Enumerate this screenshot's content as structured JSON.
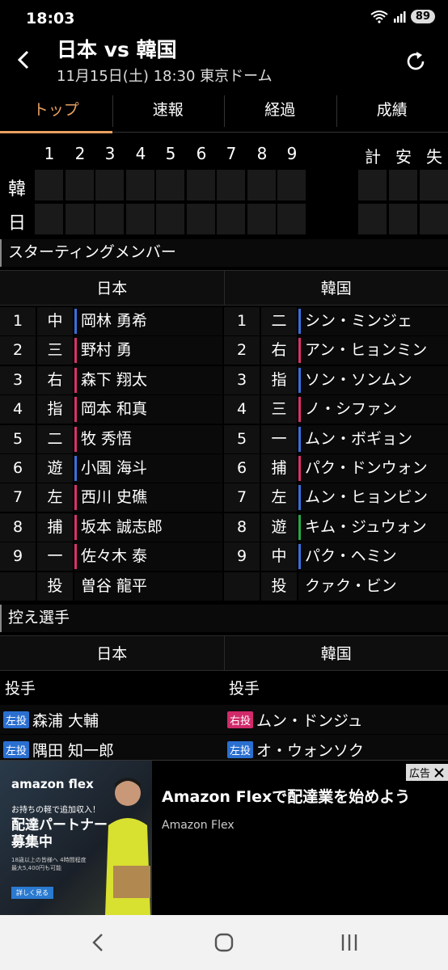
{
  "status": {
    "time": "18:03",
    "battery": "89"
  },
  "header": {
    "title": "日本 vs 韓国",
    "subtitle": "11月15日(土) 18:30 東京ドーム"
  },
  "tabs": [
    {
      "label": "トップ",
      "active": true
    },
    {
      "label": "速報",
      "active": false
    },
    {
      "label": "経過",
      "active": false
    },
    {
      "label": "成績",
      "active": false
    }
  ],
  "scoreboard": {
    "innings": [
      "1",
      "2",
      "3",
      "4",
      "5",
      "6",
      "7",
      "8",
      "9"
    ],
    "totals": [
      "計",
      "安",
      "失"
    ],
    "teams": [
      "韓",
      "日"
    ]
  },
  "starting": {
    "title": "スターティングメンバー",
    "team_left": "日本",
    "team_right": "韓国",
    "left": [
      {
        "num": "1",
        "pos": "中",
        "name": "岡林 勇希",
        "bar": "#3a6fd8"
      },
      {
        "num": "2",
        "pos": "三",
        "name": "野村 勇",
        "bar": "#d8336a"
      },
      {
        "num": "3",
        "pos": "右",
        "name": "森下 翔太",
        "bar": "#d8336a"
      },
      {
        "num": "4",
        "pos": "指",
        "name": "岡本 和真",
        "bar": "#d8336a"
      },
      {
        "num": "5",
        "pos": "二",
        "name": "牧 秀悟",
        "bar": "#d8336a"
      },
      {
        "num": "6",
        "pos": "遊",
        "name": "小園 海斗",
        "bar": "#3a6fd8"
      },
      {
        "num": "7",
        "pos": "左",
        "name": "西川 史礁",
        "bar": "#d8336a"
      },
      {
        "num": "8",
        "pos": "捕",
        "name": "坂本 誠志郎",
        "bar": "#d8336a"
      },
      {
        "num": "9",
        "pos": "一",
        "name": "佐々木 泰",
        "bar": "#d8336a"
      },
      {
        "num": "",
        "pos": "投",
        "name": "曽谷 龍平",
        "bar": ""
      }
    ],
    "right": [
      {
        "num": "1",
        "pos": "二",
        "name": "シン・ミンジェ",
        "bar": "#3a6fd8"
      },
      {
        "num": "2",
        "pos": "右",
        "name": "アン・ヒョンミン",
        "bar": "#d8336a"
      },
      {
        "num": "3",
        "pos": "指",
        "name": "ソン・ソンムン",
        "bar": "#3a6fd8"
      },
      {
        "num": "4",
        "pos": "三",
        "name": "ノ・シファン",
        "bar": "#d8336a"
      },
      {
        "num": "5",
        "pos": "一",
        "name": "ムン・ボギョン",
        "bar": "#3a6fd8"
      },
      {
        "num": "6",
        "pos": "捕",
        "name": "パク・ドンウォン",
        "bar": "#d8336a"
      },
      {
        "num": "7",
        "pos": "左",
        "name": "ムン・ヒョンビン",
        "bar": "#3a6fd8"
      },
      {
        "num": "8",
        "pos": "遊",
        "name": "キム・ジュウォン",
        "bar": "#2aa84a"
      },
      {
        "num": "9",
        "pos": "中",
        "name": "パク・ヘミン",
        "bar": "#3a6fd8"
      },
      {
        "num": "",
        "pos": "投",
        "name": "クァク・ビン",
        "bar": ""
      }
    ]
  },
  "bench": {
    "title": "控え選手",
    "team_left": "日本",
    "team_right": "韓国",
    "role_left": "投手",
    "role_right": "投手",
    "rows": [
      {
        "left_badge": "左投",
        "left_badge_color": "#2a6fd0",
        "left_name": "森浦 大輔",
        "right_badge": "右投",
        "right_badge_color": "#d02a6a",
        "right_name": "ムン・ドンジュ"
      },
      {
        "left_badge": "左投",
        "left_badge_color": "#2a6fd0",
        "left_name": "隅田 知一郎",
        "right_badge": "左投",
        "right_badge_color": "#2a6fd0",
        "right_name": "オ・ウォンソク"
      }
    ]
  },
  "ad": {
    "label": "広告",
    "image_brand": "amazon flex",
    "image_tagline": "お持ちの軽で追加収入！",
    "image_headline": "配達パートナー募集中",
    "image_fine": "18歳以上の皆様へ 4時間程度 最大5,400円も可能",
    "image_cta": "詳しく見る",
    "title": "Amazon Flexで配達業を始めよう",
    "sub": "Amazon Flex"
  }
}
